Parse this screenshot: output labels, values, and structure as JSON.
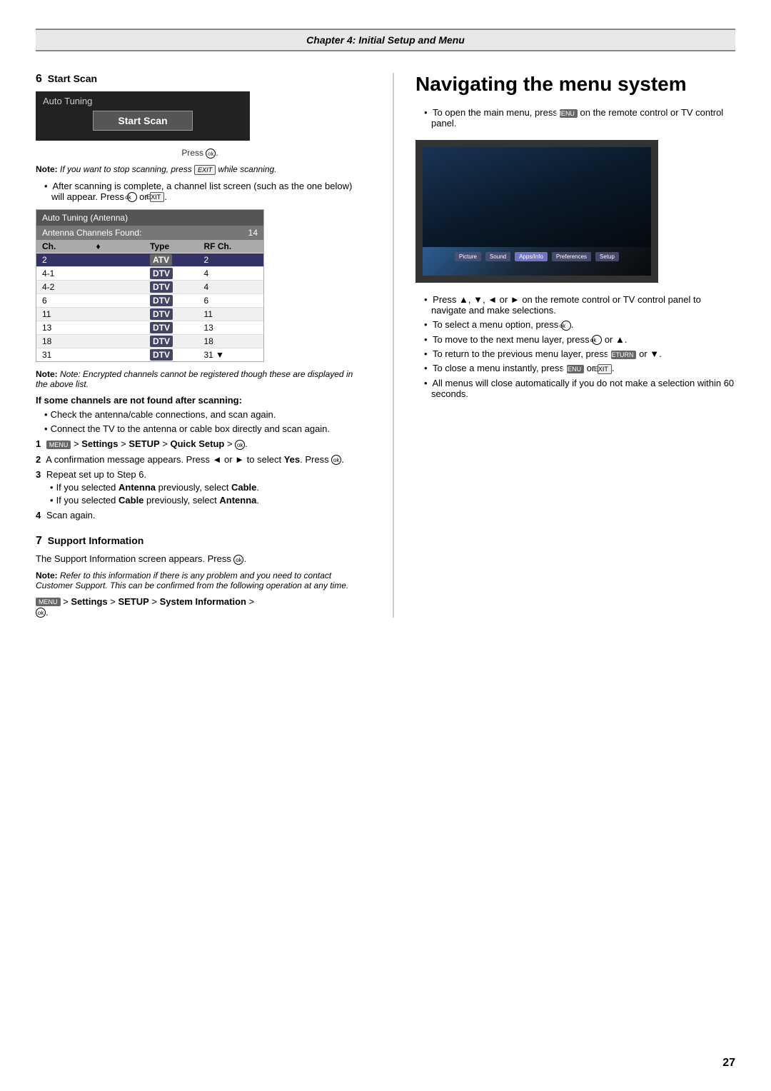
{
  "chapter": {
    "title": "Chapter 4: Initial Setup and Menu"
  },
  "left": {
    "step6": {
      "heading": "Start Scan",
      "autoTuning": {
        "title": "Auto Tuning",
        "button": "Start Scan"
      },
      "pressOk": "Press .",
      "note1": "Note: If you want to stop scanning, press  while scanning.",
      "bullet1": "After scanning is complete, a channel list screen (such as the one below) will appear. Press  or .",
      "channelTable": {
        "title": "Auto Tuning (Antenna)",
        "foundLabel": "Antenna Channels Found:",
        "foundCount": "14",
        "columns": [
          "Ch.",
          "",
          "Type",
          "RF Ch."
        ],
        "rows": [
          {
            "ch": "2",
            "type": "ATV",
            "rf": "2",
            "selected": true
          },
          {
            "ch": "4-1",
            "type": "DTV",
            "rf": "4",
            "selected": false
          },
          {
            "ch": "4-2",
            "type": "DTV",
            "rf": "4",
            "selected": false
          },
          {
            "ch": "6",
            "type": "DTV",
            "rf": "6",
            "selected": false
          },
          {
            "ch": "11",
            "type": "DTV",
            "rf": "11",
            "selected": false
          },
          {
            "ch": "13",
            "type": "DTV",
            "rf": "13",
            "selected": false
          },
          {
            "ch": "18",
            "type": "DTV",
            "rf": "18",
            "selected": false
          },
          {
            "ch": "31",
            "type": "DTV",
            "rf": "31",
            "selected": false
          }
        ]
      },
      "note2": "Note: Encrypted channels cannot be registered though these are displayed in the above list.",
      "ifSomeChannels": {
        "heading": "If some channels are not found after scanning:",
        "bullets": [
          "Check the antenna/cable connections, and scan again.",
          "Connect the TV to the antenna or cable box directly and scan again."
        ]
      },
      "numberedItems": [
        {
          "num": "1",
          "text": " > Settings > SETUP > Quick Setup > ."
        },
        {
          "num": "2",
          "text": "A confirmation message appears. Press  or  to select Yes. Press ."
        },
        {
          "num": "3",
          "text": "Repeat set up to Step 6.",
          "subBullets": [
            "If you selected Antenna previously, select Cable.",
            "If you selected Cable previously, select Antenna."
          ]
        },
        {
          "num": "4",
          "text": "Scan again."
        }
      ]
    },
    "step7": {
      "heading": "Support Information",
      "text1": "The Support Information screen appears. Press .",
      "note": "Note: Refer to this information if there is any problem and you need to contact Customer Support. This can be confirmed from the following operation at any time.",
      "path": " > Settings > SETUP > System Information > ."
    }
  },
  "right": {
    "heading": "Navigating the menu system",
    "bullets": [
      "To open the main menu, press  on the remote control or TV control panel.",
      "Press ,  ,  or  on the remote control or TV control panel to navigate and make selections.",
      "To select a menu option, press .",
      "To move to the next menu layer, press  or .",
      "To return to the previous menu layer, press  or .",
      "To close a menu instantly, press  or .",
      "All menus will close automatically if you do not make a selection within 60 seconds."
    ],
    "tvMenu": {
      "items": [
        "Picture",
        "Sound",
        "Apps/Info",
        "Preferences",
        "Setup"
      ]
    }
  },
  "page": {
    "number": "27"
  }
}
